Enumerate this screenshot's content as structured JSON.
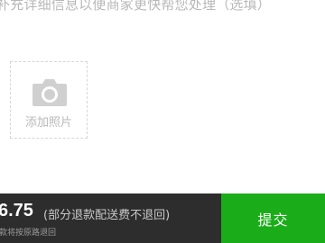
{
  "form": {
    "hint": "补充详细信息以便商家更快帮您处理（选填）"
  },
  "upload": {
    "label": "添加照片",
    "icon": "camera-icon"
  },
  "footer": {
    "amount": "6.75",
    "note": "(部分退款配送费不退回)",
    "method": "款将按原路退回",
    "submit_label": "提交"
  },
  "colors": {
    "accent": "#1aad19",
    "bar_background": "#2d2d2d",
    "placeholder_text": "#b8b8b8"
  }
}
